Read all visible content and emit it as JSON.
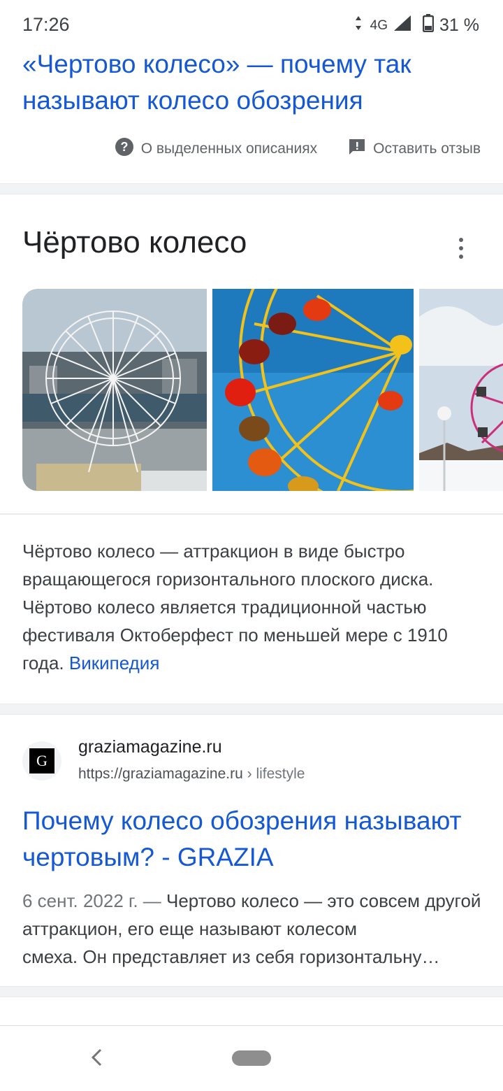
{
  "status": {
    "time": "17:26",
    "network": "4G",
    "battery": "31 %"
  },
  "top_result": {
    "title": "«Чертово колесо» — почему так называют колесо обозрения"
  },
  "feedback": {
    "about_label": "О выделенных описаниях",
    "leave_label": "Оставить отзыв"
  },
  "knowledge_panel": {
    "title": "Чёртово колесо",
    "description": "Чёртово колесо — аттракцион в виде быстро вращающегося горизонтального плоского диска. Чёртово колесо является традиционной частью фестиваля Октоберфест по меньшей мере с 1910 года.",
    "source_link": "Википедия",
    "images": [
      "ferris-wheel-city",
      "ferris-wheel-colorful",
      "ferris-wheel-snow"
    ]
  },
  "result": {
    "favicon_letter": "G",
    "site_name": "graziamagazine.ru",
    "url": "https://graziamagazine.ru",
    "breadcrumb": " › lifestyle",
    "title": "Почему колесо обозрения называют чертовым? - GRAZIA",
    "date": "6 сент. 2022 г. —",
    "snippet_1": " Чертово колесо — это совсем другой аттракцион, его еще называют колесом",
    "snippet_2": "смеха. Он представляет из себя горизонтальну…"
  },
  "colors": {
    "link": "#1558d6",
    "text": "#202124",
    "muted": "#70757a",
    "separator": "#f1f3f4"
  },
  "icons": [
    "signal-arrows-icon",
    "signal-strength-icon",
    "battery-icon",
    "help-circle-icon",
    "feedback-icon",
    "more-vert-icon",
    "back-icon"
  ]
}
